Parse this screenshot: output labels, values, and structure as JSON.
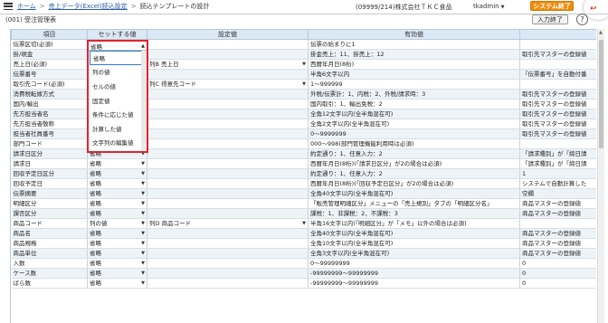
{
  "header": {
    "home_link": "ホーム",
    "breadcrumb_parent": "売上データ(Excel)読込設定",
    "breadcrumb_current": "読込テンプレートの設計",
    "company": "(09999/214)株式会社ＴＫＣ食品",
    "user": "tkadmin",
    "system_end": "システム終了"
  },
  "subheader": {
    "title": "(001) 受注管理表",
    "input_end": "入力終了",
    "help": "?"
  },
  "table": {
    "columns": [
      "項目",
      "セットする値",
      "設定値",
      "有効値",
      ""
    ],
    "rows": [
      {
        "item": "伝票区切(必須)",
        "set": "省略",
        "config": "",
        "config_has_arrow": false,
        "valid": "伝票の始まりに1",
        "note": ""
      },
      {
        "item": "掛/現金",
        "set": "",
        "config": "",
        "config_has_arrow": false,
        "valid": "掛金売上：11、掛売上：12",
        "note": "取引先マスターの登録値"
      },
      {
        "item": "売上日(必須)",
        "set": "",
        "config": "列B 売上日",
        "config_has_arrow": true,
        "valid": "西暦年月日(8桁)",
        "note": ""
      },
      {
        "item": "伝票番号",
        "set": "",
        "config": "",
        "config_has_arrow": false,
        "valid": "半角6文字以内",
        "note": "「伝票番号」を自動付番"
      },
      {
        "item": "取引先コード(必須)",
        "set": "",
        "config": "列C 得意先コード",
        "config_has_arrow": true,
        "valid": "1〜999999",
        "note": ""
      },
      {
        "item": "消費税転嫁方式",
        "set": "",
        "config": "",
        "config_has_arrow": false,
        "valid": "外税/伝票計：1、内税：2、外税/請求時：3",
        "note": "取引先マスターの登録値"
      },
      {
        "item": "国内/輸出",
        "set": "",
        "config": "",
        "config_has_arrow": false,
        "valid": "国内取引：1、輸出免税：2",
        "note": "取引先マスターの登録値"
      },
      {
        "item": "先方担当者名",
        "set": "",
        "config": "",
        "config_has_arrow": false,
        "valid": "全角12文字以内(全半角混在可)",
        "note": "取引先マスターの登録値"
      },
      {
        "item": "先方担当者敬称",
        "set": "",
        "config": "",
        "config_has_arrow": false,
        "valid": "全角2文字以内(全半角混在可)",
        "note": "取引先マスターの登録値"
      },
      {
        "item": "担当者社員番号",
        "set": "",
        "config": "",
        "config_has_arrow": false,
        "valid": "0〜9999999",
        "note": "取引先マスターの登録値"
      },
      {
        "item": "部門コード",
        "set": "省略",
        "config": "",
        "config_has_arrow": false,
        "valid": "000〜998(部門管理機能利用時は必須)",
        "note": ""
      },
      {
        "item": "請求日区分",
        "set": "省略",
        "config": "",
        "config_has_arrow": false,
        "valid": "約定通り：1、任意入力：2",
        "note": "「請求種別」が「締日請"
      },
      {
        "item": "請求日",
        "set": "省略",
        "config": "",
        "config_has_arrow": false,
        "valid": "西暦年月日(8桁)(「請求日区分」が2の場合は必須)",
        "note": "「請求種別」が「締日請"
      },
      {
        "item": "回収予定日区分",
        "set": "省略",
        "config": "",
        "config_has_arrow": false,
        "valid": "約定通り：1、任意入力：2",
        "note": "1"
      },
      {
        "item": "回収予定日",
        "set": "省略",
        "config": "",
        "config_has_arrow": false,
        "valid": "西暦年月日(8桁)(「回収予定日区分」が2の場合は必須)",
        "note": "システムで自動計算した"
      },
      {
        "item": "伝票摘要",
        "set": "省略",
        "config": "",
        "config_has_arrow": false,
        "valid": "全角40文字以内(全半角混在可)",
        "note": "空欄"
      },
      {
        "item": "明細区分",
        "set": "省略",
        "config": "",
        "config_has_arrow": false,
        "valid": "「販売管理明細区分」メニューの「売上規別」タブの「明細区分名」",
        "note": "商品マスターの登録値"
      },
      {
        "item": "課否区分",
        "set": "省略",
        "config": "",
        "config_has_arrow": false,
        "valid": "課税：1、非課税：2、不課税：3",
        "note": "商品マスターの登録値"
      },
      {
        "item": "商品コード",
        "set": "列の値",
        "config": "列D 商品コード",
        "config_has_arrow": true,
        "valid": "半角16文字以内(「明細区分」が「メモ」以外の場合は必須)",
        "note": ""
      },
      {
        "item": "商品名",
        "set": "省略",
        "config": "",
        "config_has_arrow": false,
        "valid": "全角40文字以内(全半角混在可)",
        "note": "商品マスターの登録値"
      },
      {
        "item": "商品規格",
        "set": "省略",
        "config": "",
        "config_has_arrow": false,
        "valid": "全角10文字以内(全半角混在可)",
        "note": "商品マスターの登録値"
      },
      {
        "item": "商品単位",
        "set": "省略",
        "config": "",
        "config_has_arrow": false,
        "valid": "全角3文字以内(全半角混在可)",
        "note": "商品マスターの登録値"
      },
      {
        "item": "入数",
        "set": "省略",
        "config": "",
        "config_has_arrow": false,
        "valid": "0〜99999999",
        "note": "0"
      },
      {
        "item": "ケース数",
        "set": "省略",
        "config": "",
        "config_has_arrow": false,
        "valid": "-99999999〜99999999",
        "note": "0"
      },
      {
        "item": "ばら数",
        "set": "省略",
        "config": "",
        "config_has_arrow": false,
        "valid": "-99999999〜99999999",
        "note": "0"
      }
    ]
  },
  "dropdown": {
    "selected": "省略",
    "options": [
      "省略",
      "列の値",
      "セルの値",
      "固定値",
      "条件に応じた値",
      "計算した値",
      "文字列の編集値"
    ],
    "highlighted_index": 0
  },
  "colors": {
    "header_bg": "#dbe8f5",
    "alt_row": "#eef3f8",
    "highlight_border": "#e3232e",
    "system_end_bg": "#f08c0a",
    "link": "#2a5ba8"
  }
}
